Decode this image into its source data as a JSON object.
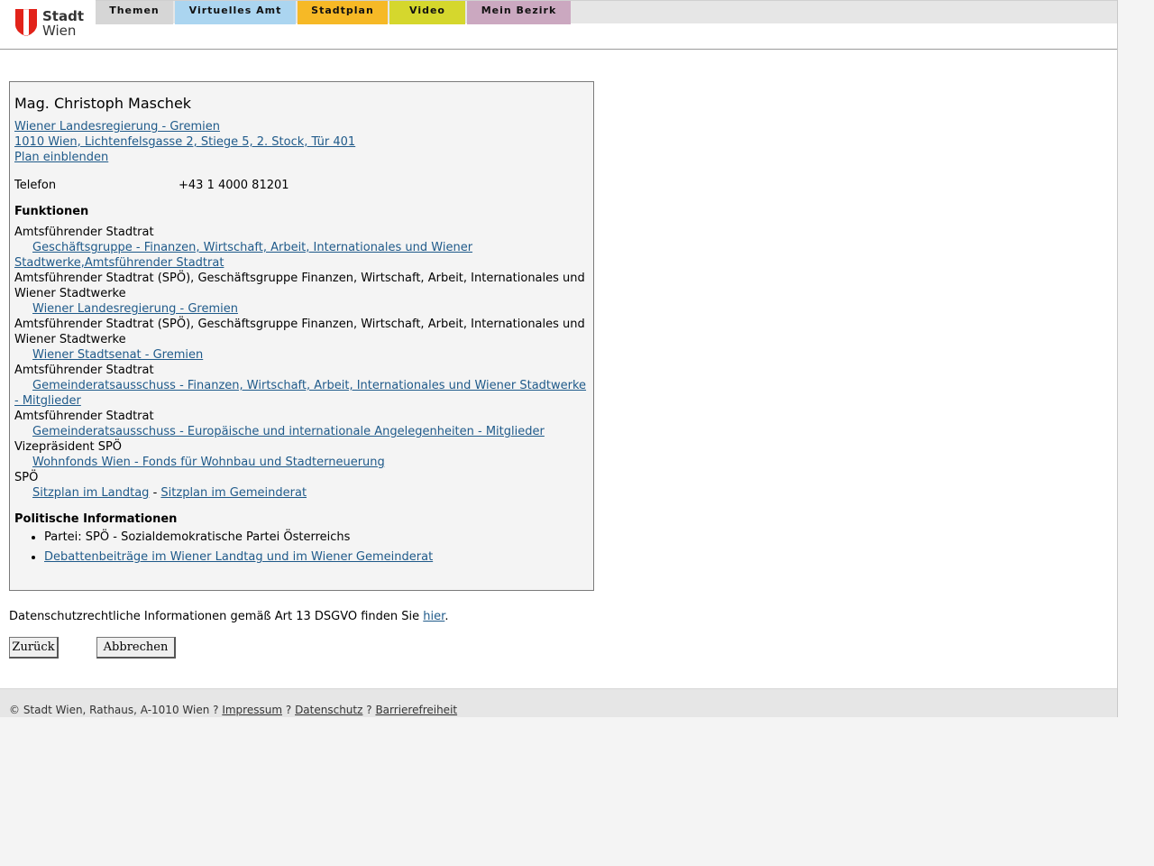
{
  "header": {
    "logo": {
      "line1": "Stadt",
      "line2": "Wien"
    },
    "nav": [
      {
        "label": "Themen",
        "color": "#d6d6d6"
      },
      {
        "label": "Virtuelles Amt",
        "color": "#abd5f0"
      },
      {
        "label": "Stadtplan",
        "color": "#f6b926"
      },
      {
        "label": "Video",
        "color": "#d5d72d"
      },
      {
        "label": "Mein Bezirk",
        "color": "#cba8c0"
      }
    ]
  },
  "profile": {
    "name": "Mag. Christoph Maschek",
    "org_link": "Wiener Landesregierung - Gremien",
    "address_link": "1010 Wien, Lichtenfelsgasse 2, Stiege 5, 2. Stock, Tür 401",
    "plan_link": "Plan einblenden",
    "phone_label": "Telefon",
    "phone_value": "+43 1 4000 81201",
    "functions_heading": "Funktionen",
    "functions": {
      "f1_role": "Amtsführender Stadtrat",
      "f1_link_a": "Geschäftsgruppe - Finanzen, Wirtschaft, Arbeit, Internationales und Wiener",
      "f1_link_b": "Stadtwerke,Amtsführender Stadtrat",
      "f2_role_a": "Amtsführender Stadtrat (SPÖ), Geschäftsgruppe Finanzen, Wirtschaft, Arbeit, Internationales und",
      "f2_role_b": "Wiener Stadtwerke",
      "f2_link": "Wiener Landesregierung - Gremien",
      "f3_role_a": "Amtsführender Stadtrat (SPÖ), Geschäftsgruppe Finanzen, Wirtschaft, Arbeit, Internationales und",
      "f3_role_b": "Wiener Stadtwerke",
      "f3_link": "Wiener Stadtsenat - Gremien",
      "f4_role": "Amtsführender Stadtrat",
      "f4_link_a": "Gemeinderatsausschuss - Finanzen, Wirtschaft, Arbeit, Internationales und Wiener Stadtwerke",
      "f4_link_b": "- Mitglieder",
      "f5_role": "Amtsführender Stadtrat",
      "f5_link": "Gemeinderatsausschuss - Europäische und internationale Angelegenheiten - Mitglieder",
      "f6_role": "Vizepräsident SPÖ",
      "f6_link": "Wohnfonds Wien - Fonds für Wohnbau und Stadterneuerung",
      "f7_role": "SPÖ",
      "f7_link_landtag": "Sitzplan im Landtag",
      "f7_separator": "-",
      "f7_link_gemeinderat": "Sitzplan im Gemeinderat"
    },
    "political_heading": "Politische Informationen",
    "party": "Partei: SPÖ - Sozialdemokratische Partei Österreichs",
    "debates_link": "Debattenbeiträge im Wiener Landtag und im Wiener Gemeinderat"
  },
  "privacy": {
    "text": "Datenschutzrechtliche Informationen gemäß Art 13 DSGVO finden Sie",
    "link": "hier",
    "end": "."
  },
  "buttons": {
    "back": "Zurück",
    "cancel": "Abbrechen"
  },
  "footer": {
    "copyright": "© Stadt Wien, Rathaus, A-1010 Wien ?",
    "impressum": "Impressum",
    "sep1": "?",
    "datenschutz": "Datenschutz",
    "sep2": "?",
    "barrierefreiheit": "Barrierefreiheit"
  }
}
